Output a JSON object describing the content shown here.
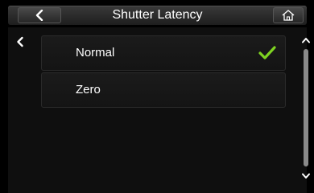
{
  "header": {
    "title": "Shutter Latency",
    "back_icon": "chevron-left-icon",
    "home_icon": "home-icon"
  },
  "sidebar": {
    "back_icon": "chevron-left-icon"
  },
  "options": [
    {
      "label": "Normal",
      "selected": true
    },
    {
      "label": "Zero",
      "selected": false
    }
  ],
  "scrollbar": {
    "up_icon": "chevron-up-icon",
    "down_icon": "chevron-down-icon",
    "thumb_fraction": 1.0
  },
  "colors": {
    "check": "#7ed321",
    "background": "#000000"
  }
}
